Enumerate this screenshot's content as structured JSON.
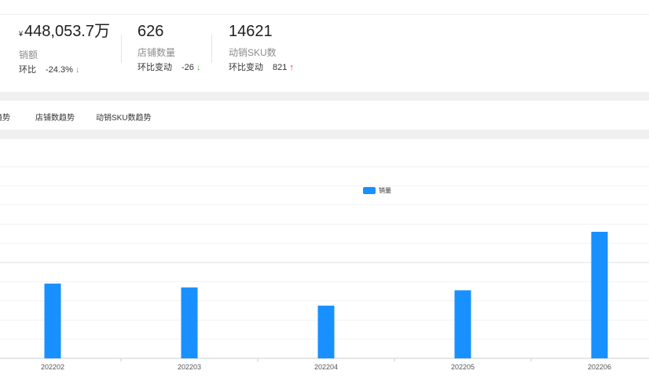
{
  "stats": [
    {
      "currency": "¥",
      "value": "448,053.7万",
      "label": "销额",
      "change_label": "环比",
      "change_value": "-24.3%",
      "direction": "down",
      "arrow": "↓"
    },
    {
      "value": "626",
      "label": "店铺数量",
      "change_label": "环比变动",
      "change_value": "-26",
      "direction": "down",
      "arrow": "↓"
    },
    {
      "value": "14621",
      "label": "动销SKU数",
      "change_label": "环比变动",
      "change_value": "821",
      "direction": "up",
      "arrow": "↑"
    }
  ],
  "tabs": [
    "趋势",
    "店铺数趋势",
    "动销SKU数趋势"
  ],
  "colors": {
    "bar": "#1890ff",
    "down": "#52c41a",
    "up": "#f5222d"
  },
  "chart_data": {
    "type": "bar",
    "categories": [
      "202202",
      "202203",
      "202204",
      "202205",
      "202206"
    ],
    "series": [
      {
        "name": "销量",
        "values": [
          3.9,
          3.7,
          2.75,
          3.55,
          6.6
        ]
      }
    ],
    "ylim": [
      0,
      10
    ],
    "grid": true,
    "legend": "top-center"
  }
}
